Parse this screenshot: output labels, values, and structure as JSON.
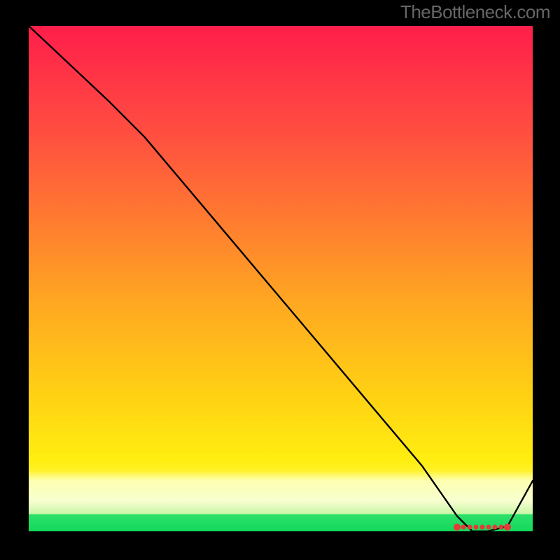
{
  "attribution": "TheBottleneck.com",
  "chart_data": {
    "type": "line",
    "title": "",
    "xlabel": "",
    "ylabel": "",
    "ylim": [
      0,
      100
    ],
    "xlim": [
      0,
      100
    ],
    "x": [
      0,
      16,
      23,
      34,
      45,
      56,
      67,
      78,
      85,
      88,
      91,
      95,
      100
    ],
    "values": [
      100,
      85,
      78,
      65,
      52,
      39,
      26,
      13,
      3,
      0,
      0,
      1,
      10
    ],
    "optimal_range_x": [
      85,
      95
    ],
    "background_gradient": {
      "top": "#ff1e4b",
      "mid": "#ffcf14",
      "band": "#fdffb0",
      "bottom": "#12d85b"
    }
  }
}
